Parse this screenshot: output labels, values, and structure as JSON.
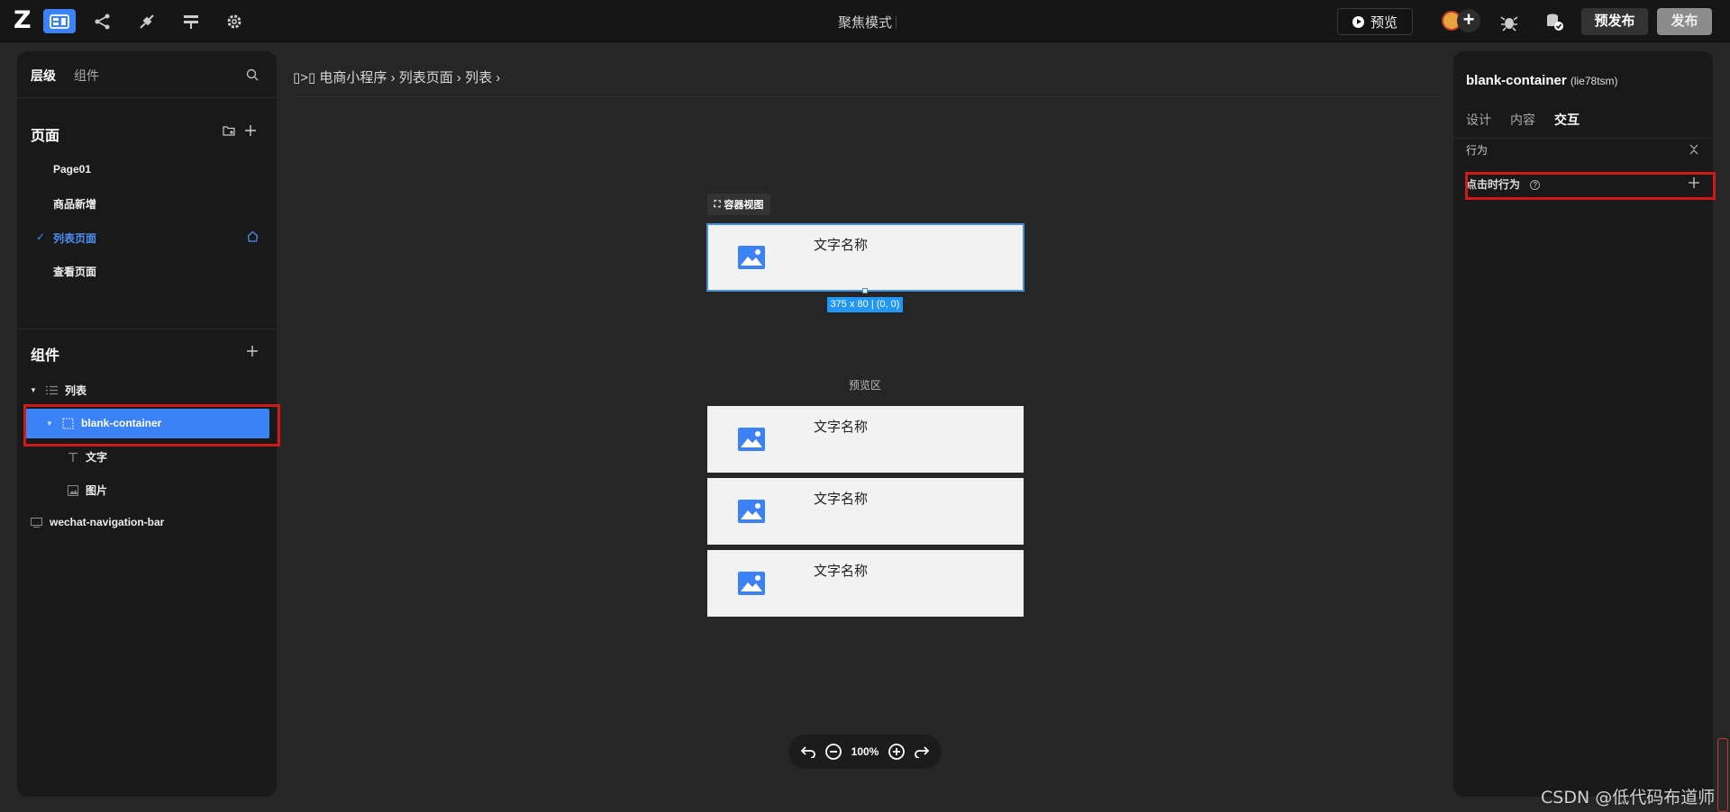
{
  "app": {
    "logo": "Z",
    "mode_title": "聚焦模式"
  },
  "toolbar": {
    "tools": [
      "layout-icon",
      "flow-icon",
      "plugin-icon",
      "style-icon",
      "gear-icon"
    ],
    "preview_label": "预览",
    "pre_publish_label": "预发布",
    "publish_label": "发布"
  },
  "left_panel": {
    "tabs": [
      "层级",
      "组件"
    ],
    "active_tab": "层级",
    "pages_title": "页面",
    "pages": [
      {
        "label": "Page01",
        "active": false
      },
      {
        "label": "商品新增",
        "active": false
      },
      {
        "label": "列表页面",
        "active": true
      },
      {
        "label": "查看页面",
        "active": false
      }
    ],
    "components_title": "组件",
    "tree": [
      {
        "label": "列表",
        "icon": "list-icon"
      },
      {
        "label": "blank-container",
        "icon": "container-icon",
        "selected": true
      },
      {
        "label": "文字",
        "icon": "text-icon"
      },
      {
        "label": "图片",
        "icon": "image-icon"
      },
      {
        "label": "wechat-navigation-bar",
        "icon": "navbar-icon"
      }
    ]
  },
  "canvas": {
    "breadcrumb": "▯>▯ 电商小程序 › 列表页面 › 列表 ›",
    "container_view_label": "容器视图",
    "card_text": "文字名称",
    "selection_dims": "375 x 80 | (0, 0)",
    "preview_area_label": "预览区",
    "zoom_level": "100%"
  },
  "right_panel": {
    "title": "blank-container",
    "subtitle": "(lie78tsm)",
    "tabs": [
      "设计",
      "内容",
      "交互"
    ],
    "active_tab": "交互",
    "section": "行为",
    "action_label": "点击时行为"
  },
  "watermark": "CSDN @低代码布道师",
  "colors": {
    "accent": "#3b82f6",
    "highlight_box": "#d01919",
    "background": "#262626",
    "panel": "#191919"
  }
}
